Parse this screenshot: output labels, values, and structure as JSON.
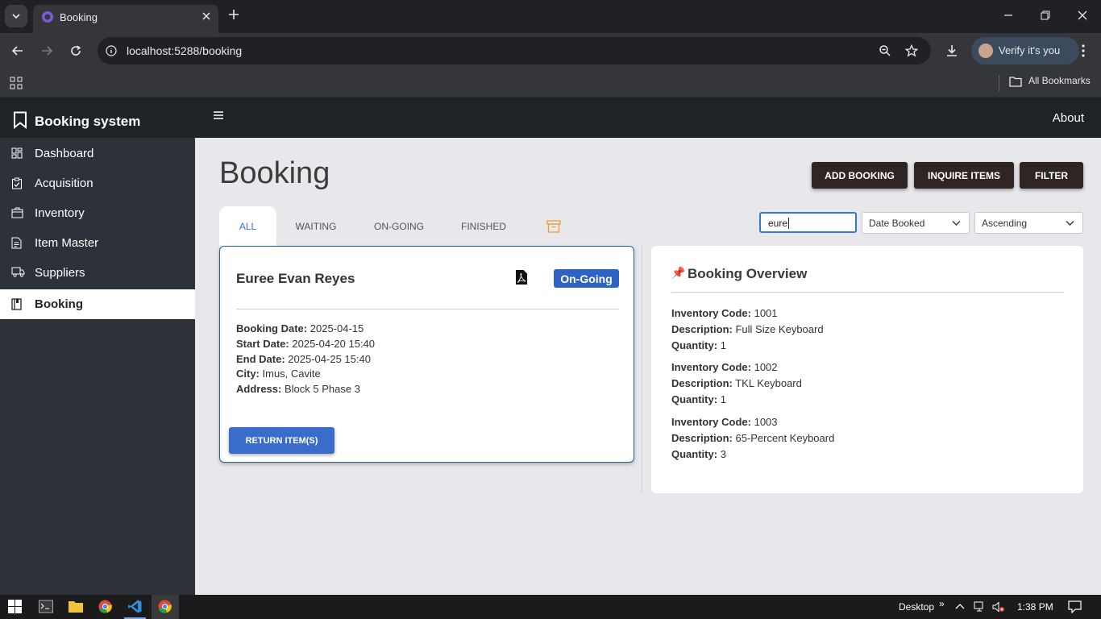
{
  "browser": {
    "tab_title": "Booking",
    "url": "localhost:5288/booking",
    "profile_label": "Verify it's you",
    "bookmarks_label": "All Bookmarks"
  },
  "sidebar": {
    "brand": "Booking system",
    "items": [
      {
        "label": "Dashboard",
        "icon": "dashboard-icon"
      },
      {
        "label": "Acquisition",
        "icon": "clipboard-check-icon"
      },
      {
        "label": "Inventory",
        "icon": "inventory-box-icon"
      },
      {
        "label": "Item Master",
        "icon": "document-icon"
      },
      {
        "label": "Suppliers",
        "icon": "truck-icon"
      },
      {
        "label": "Booking",
        "icon": "book-icon",
        "active": true
      }
    ]
  },
  "appbar": {
    "about_label": "About"
  },
  "page": {
    "title": "Booking",
    "actions": {
      "add": "ADD BOOKING",
      "inquire": "INQUIRE ITEMS",
      "filter": "FILTER"
    },
    "tabs": [
      "ALL",
      "WAITING",
      "ON-GOING",
      "FINISHED"
    ],
    "active_tab": "ALL",
    "search_value": "eure",
    "sort_field": "Date Booked",
    "sort_order": "Ascending"
  },
  "booking_card": {
    "name": "Euree Evan Reyes",
    "status": "On-Going",
    "fields": [
      {
        "label": "Booking Date:",
        "value": "2025-04-15"
      },
      {
        "label": "Start Date:",
        "value": "2025-04-20 15:40"
      },
      {
        "label": "End Date:",
        "value": "2025-04-25 15:40"
      },
      {
        "label": "City:",
        "value": "Imus, Cavite"
      },
      {
        "label": "Address:",
        "value": "Block 5 Phase 3"
      }
    ],
    "return_label": "RETURN ITEM(S)"
  },
  "overview": {
    "title": "Booking Overview",
    "pin": "📌",
    "items": [
      {
        "code_label": "Inventory Code:",
        "code": "1001",
        "desc_label": "Description:",
        "desc": "Full Size Keyboard",
        "qty_label": "Quantity:",
        "qty": "1"
      },
      {
        "code_label": "Inventory Code:",
        "code": "1002",
        "desc_label": "Description:",
        "desc": "TKL Keyboard",
        "qty_label": "Quantity:",
        "qty": "1"
      },
      {
        "code_label": "Inventory Code:",
        "code": "1003",
        "desc_label": "Description:",
        "desc": "65-Percent Keyboard",
        "qty_label": "Quantity:",
        "qty": "3"
      }
    ]
  },
  "taskbar": {
    "desktop_label": "Desktop",
    "time": "1:38 PM"
  },
  "colors": {
    "accent": "#3a6cc9",
    "dark": "#1f2326",
    "sidebar": "#2d3238",
    "action_button": "#2f2624"
  }
}
